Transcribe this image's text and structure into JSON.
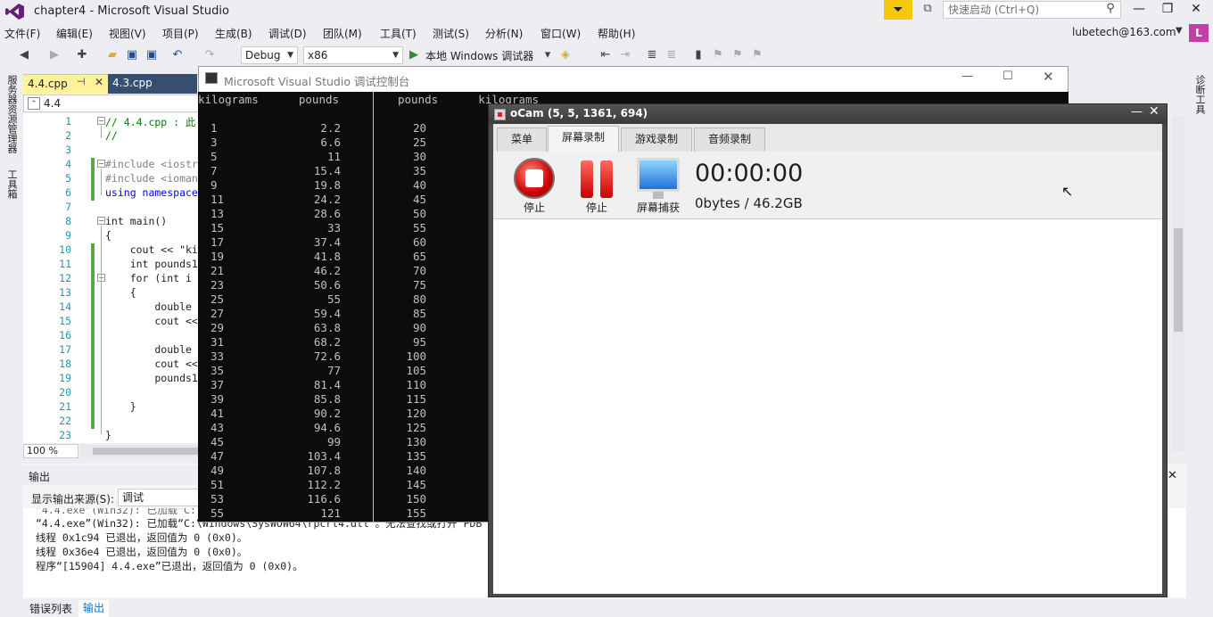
{
  "window": {
    "title": "chapter4 - Microsoft Visual Studio",
    "quick_launch_placeholder": "快速启动 (Ctrl+Q)"
  },
  "menu": [
    "文件(F)",
    "编辑(E)",
    "视图(V)",
    "项目(P)",
    "生成(B)",
    "调试(D)",
    "团队(M)",
    "工具(T)",
    "测试(S)",
    "分析(N)",
    "窗口(W)",
    "帮助(H)"
  ],
  "account": {
    "email": "lubetech@163.com",
    "avatar_letter": "L"
  },
  "toolbar": {
    "config": "Debug",
    "platform": "x86",
    "run_label": "本地 Windows 调试器"
  },
  "left_strip": {
    "item1": "服务器资源管理器",
    "item2": "工具箱"
  },
  "right_strip": {
    "item1": "诊断工具"
  },
  "editor": {
    "tabs": [
      {
        "label": "4.4.cpp",
        "active": true
      },
      {
        "label": "4.3.cpp",
        "active": false
      }
    ],
    "nav_scope": "4.4",
    "zoom": "100 %",
    "lines": [
      {
        "n": "1",
        "text": "// 4.4.cpp : 此"
      },
      {
        "n": "2",
        "text": "//"
      },
      {
        "n": "3",
        "text": ""
      },
      {
        "n": "4",
        "text": "#include <iostr"
      },
      {
        "n": "5",
        "text": "#include <ioman"
      },
      {
        "n": "6",
        "text": "using namespace"
      },
      {
        "n": "7",
        "text": ""
      },
      {
        "n": "8",
        "text": "int main()"
      },
      {
        "n": "9",
        "text": "{"
      },
      {
        "n": "10",
        "text": "    cout << \"ki"
      },
      {
        "n": "11",
        "text": "    int pounds1"
      },
      {
        "n": "12",
        "text": "    for (int i"
      },
      {
        "n": "13",
        "text": "    {"
      },
      {
        "n": "14",
        "text": "        double"
      },
      {
        "n": "15",
        "text": "        cout <<"
      },
      {
        "n": "16",
        "text": ""
      },
      {
        "n": "17",
        "text": "        double"
      },
      {
        "n": "18",
        "text": "        cout <<"
      },
      {
        "n": "19",
        "text": "        pounds1"
      },
      {
        "n": "20",
        "text": ""
      },
      {
        "n": "21",
        "text": "    }"
      },
      {
        "n": "22",
        "text": ""
      },
      {
        "n": "23",
        "text": "}"
      }
    ]
  },
  "output": {
    "title": "输出",
    "source_label": "显示输出来源(S):",
    "source_value": "调试",
    "lines": [
      "“4.4.exe”(Win32): 已加载“C:\\Windows\\SysWOW64\\rpcrt4.dll”。无法查找或打开 PDB 文件",
      "线程 0x1c94 已退出，返回值为 0 (0x0)。",
      "线程 0x36e4 已退出，返回值为 0 (0x0)。",
      "程序“[15904] 4.4.exe”已退出，返回值为 0 (0x0)。"
    ],
    "partial_top_line": "“4.4.exe”(Win32): 已加载“C:"
  },
  "bottom_tabs": [
    "错误列表",
    "输出"
  ],
  "console": {
    "title": "Microsoft Visual Studio 调试控制台",
    "header_left": "kilograms      pounds",
    "header_right": "pounds      kilograms",
    "rows": [
      [
        "1",
        "2.2",
        "20"
      ],
      [
        "3",
        "6.6",
        "25"
      ],
      [
        "5",
        "11",
        "30"
      ],
      [
        "7",
        "15.4",
        "35"
      ],
      [
        "9",
        "19.8",
        "40"
      ],
      [
        "11",
        "24.2",
        "45"
      ],
      [
        "13",
        "28.6",
        "50"
      ],
      [
        "15",
        "33",
        "55"
      ],
      [
        "17",
        "37.4",
        "60"
      ],
      [
        "19",
        "41.8",
        "65"
      ],
      [
        "21",
        "46.2",
        "70"
      ],
      [
        "23",
        "50.6",
        "75"
      ],
      [
        "25",
        "55",
        "80"
      ],
      [
        "27",
        "59.4",
        "85"
      ],
      [
        "29",
        "63.8",
        "90"
      ],
      [
        "31",
        "68.2",
        "95"
      ],
      [
        "33",
        "72.6",
        "100"
      ],
      [
        "35",
        "77",
        "105"
      ],
      [
        "37",
        "81.4",
        "110"
      ],
      [
        "39",
        "85.8",
        "115"
      ],
      [
        "41",
        "90.2",
        "120"
      ],
      [
        "43",
        "94.6",
        "125"
      ],
      [
        "45",
        "99",
        "130"
      ],
      [
        "47",
        "103.4",
        "135"
      ],
      [
        "49",
        "107.8",
        "140"
      ],
      [
        "51",
        "112.2",
        "145"
      ],
      [
        "53",
        "116.6",
        "150"
      ],
      [
        "55",
        "121",
        "155"
      ]
    ]
  },
  "ocam": {
    "title": "oCam (5, 5, 1361, 694)",
    "tabs": [
      "菜单",
      "屏幕录制",
      "游戏录制",
      "音频录制"
    ],
    "buttons": {
      "stop": "停止",
      "pause": "停止",
      "capture": "屏幕捕获"
    },
    "time": "00:00:00",
    "size": "0bytes / 46.2GB"
  }
}
